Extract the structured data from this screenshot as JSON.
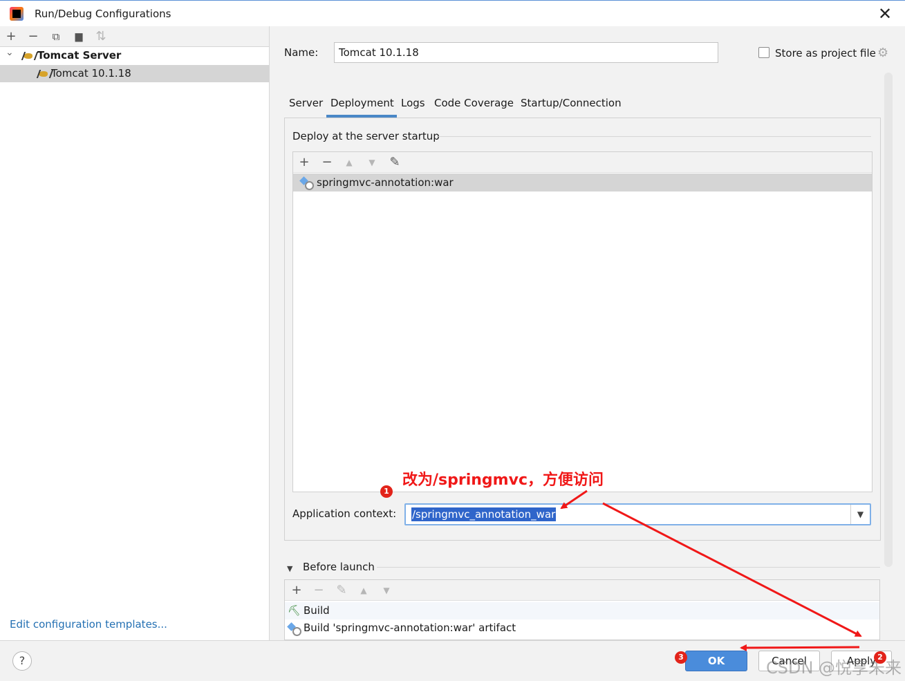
{
  "window": {
    "title": "Run/Debug Configurations",
    "close": "✕"
  },
  "left_toolbar": {
    "add": "+",
    "remove": "−",
    "copy": "⧉",
    "folder": "▆",
    "sort": "⇅"
  },
  "tree": {
    "group_caret": "⌄",
    "group_label": "Tomcat Server",
    "child_label": "Tomcat 10.1.18"
  },
  "edit_templates": "Edit configuration templates...",
  "name_label": "Name:",
  "name_value": "Tomcat 10.1.18",
  "store_label": "Store as project file",
  "store_gear": "⚙",
  "tabs": [
    "Server",
    "Deployment",
    "Logs",
    "Code Coverage",
    "Startup/Connection"
  ],
  "deploy": {
    "title": "Deploy at the server startup",
    "toolbar": {
      "add": "+",
      "remove": "−",
      "up": "▲",
      "down": "▼",
      "edit": "✎"
    },
    "items": [
      "springmvc-annotation:war"
    ]
  },
  "app_context": {
    "label": "Application context:",
    "value": "/springmvc_annotation_war",
    "dropdown": "▼"
  },
  "annotation": {
    "text": "改为/springmvc，方便访问",
    "badges": [
      "1",
      "2",
      "3"
    ],
    "color": "#f01818"
  },
  "before_launch": {
    "caret": "▼",
    "title": "Before launch",
    "toolbar": {
      "add": "+",
      "remove": "−",
      "edit": "✎",
      "up": "▲",
      "down": "▼"
    },
    "items": [
      "Build",
      "Build 'springmvc-annotation:war' artifact"
    ],
    "build_icon": "⛏"
  },
  "buttons": {
    "help": "?",
    "ok": "OK",
    "cancel": "Cancel",
    "apply": "Apply"
  },
  "watermark": "CSDN @悦享未来",
  "colors": {
    "accent": "#4a88c7",
    "selection": "#d5d5d5",
    "ok_button": "#4a8cdb",
    "link": "#2470b3"
  }
}
